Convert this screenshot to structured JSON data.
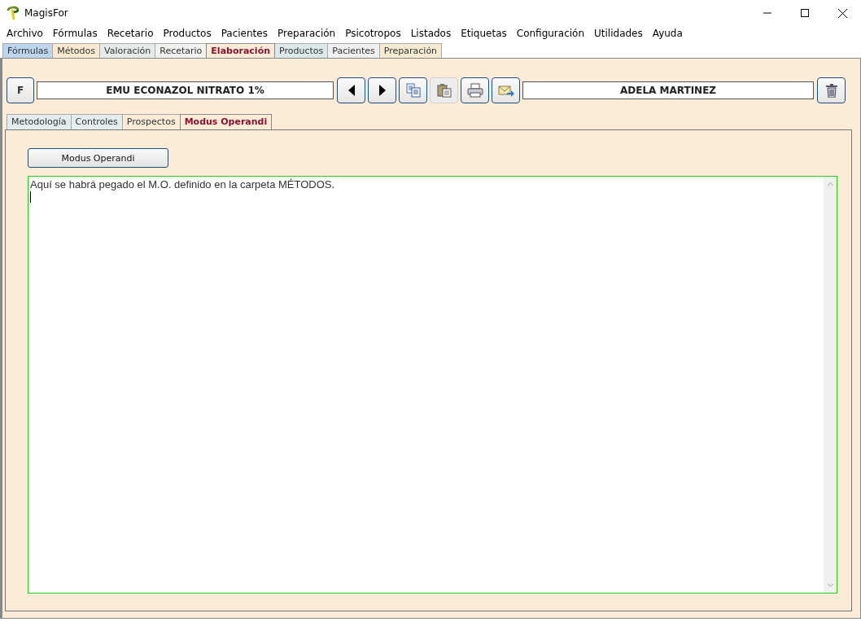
{
  "window": {
    "title": "MagisFor"
  },
  "menu": [
    "Archivo",
    "Fórmulas",
    "Recetario",
    "Productos",
    "Pacientes",
    "Preparación",
    "Psicotropos",
    "Listados",
    "Etiquetas",
    "Configuración",
    "Utilidades",
    "Ayuda"
  ],
  "tabs": [
    {
      "label": "Fórmulas",
      "selected": false,
      "color": "#bcd6ee"
    },
    {
      "label": "Métodos",
      "selected": false,
      "color": "#fbe9d0"
    },
    {
      "label": "Valoración",
      "selected": false,
      "color": "#e6ebe8"
    },
    {
      "label": "Recetario",
      "selected": false,
      "color": "#f1f1ef"
    },
    {
      "label": "Elaboración",
      "selected": true,
      "color": "#fcecd7"
    },
    {
      "label": "Productos",
      "selected": false,
      "color": "#dce8e9"
    },
    {
      "label": "Pacientes",
      "selected": false,
      "color": "#eef0f2"
    },
    {
      "label": "Preparación",
      "selected": false,
      "color": "#f6ead0"
    }
  ],
  "toolbar": {
    "f_button": "F",
    "formula": "EMU ECONAZOL NITRATO 1%",
    "buttons": [
      {
        "kind": "prev",
        "disabled": false
      },
      {
        "kind": "next",
        "disabled": false
      },
      {
        "kind": "copy",
        "disabled": false
      },
      {
        "kind": "paste",
        "disabled": true
      },
      {
        "kind": "print",
        "disabled": false
      },
      {
        "kind": "mail",
        "disabled": false
      }
    ],
    "patient": "ADELA MARTINEZ"
  },
  "subtabs": [
    {
      "label": "Metodología",
      "selected": false,
      "color": "#e3ecee"
    },
    {
      "label": "Controles",
      "selected": false,
      "color": "#e3ecee"
    },
    {
      "label": "Prospectos",
      "selected": false,
      "color": "#fcecd7"
    },
    {
      "label": "Modus Operandi",
      "selected": true,
      "color": "#fcecd7"
    }
  ],
  "action_button": "Modus Operandi",
  "editor": {
    "value": "Aquí se habrá pegado el M.O. definido en la carpeta MÉTODOS."
  }
}
